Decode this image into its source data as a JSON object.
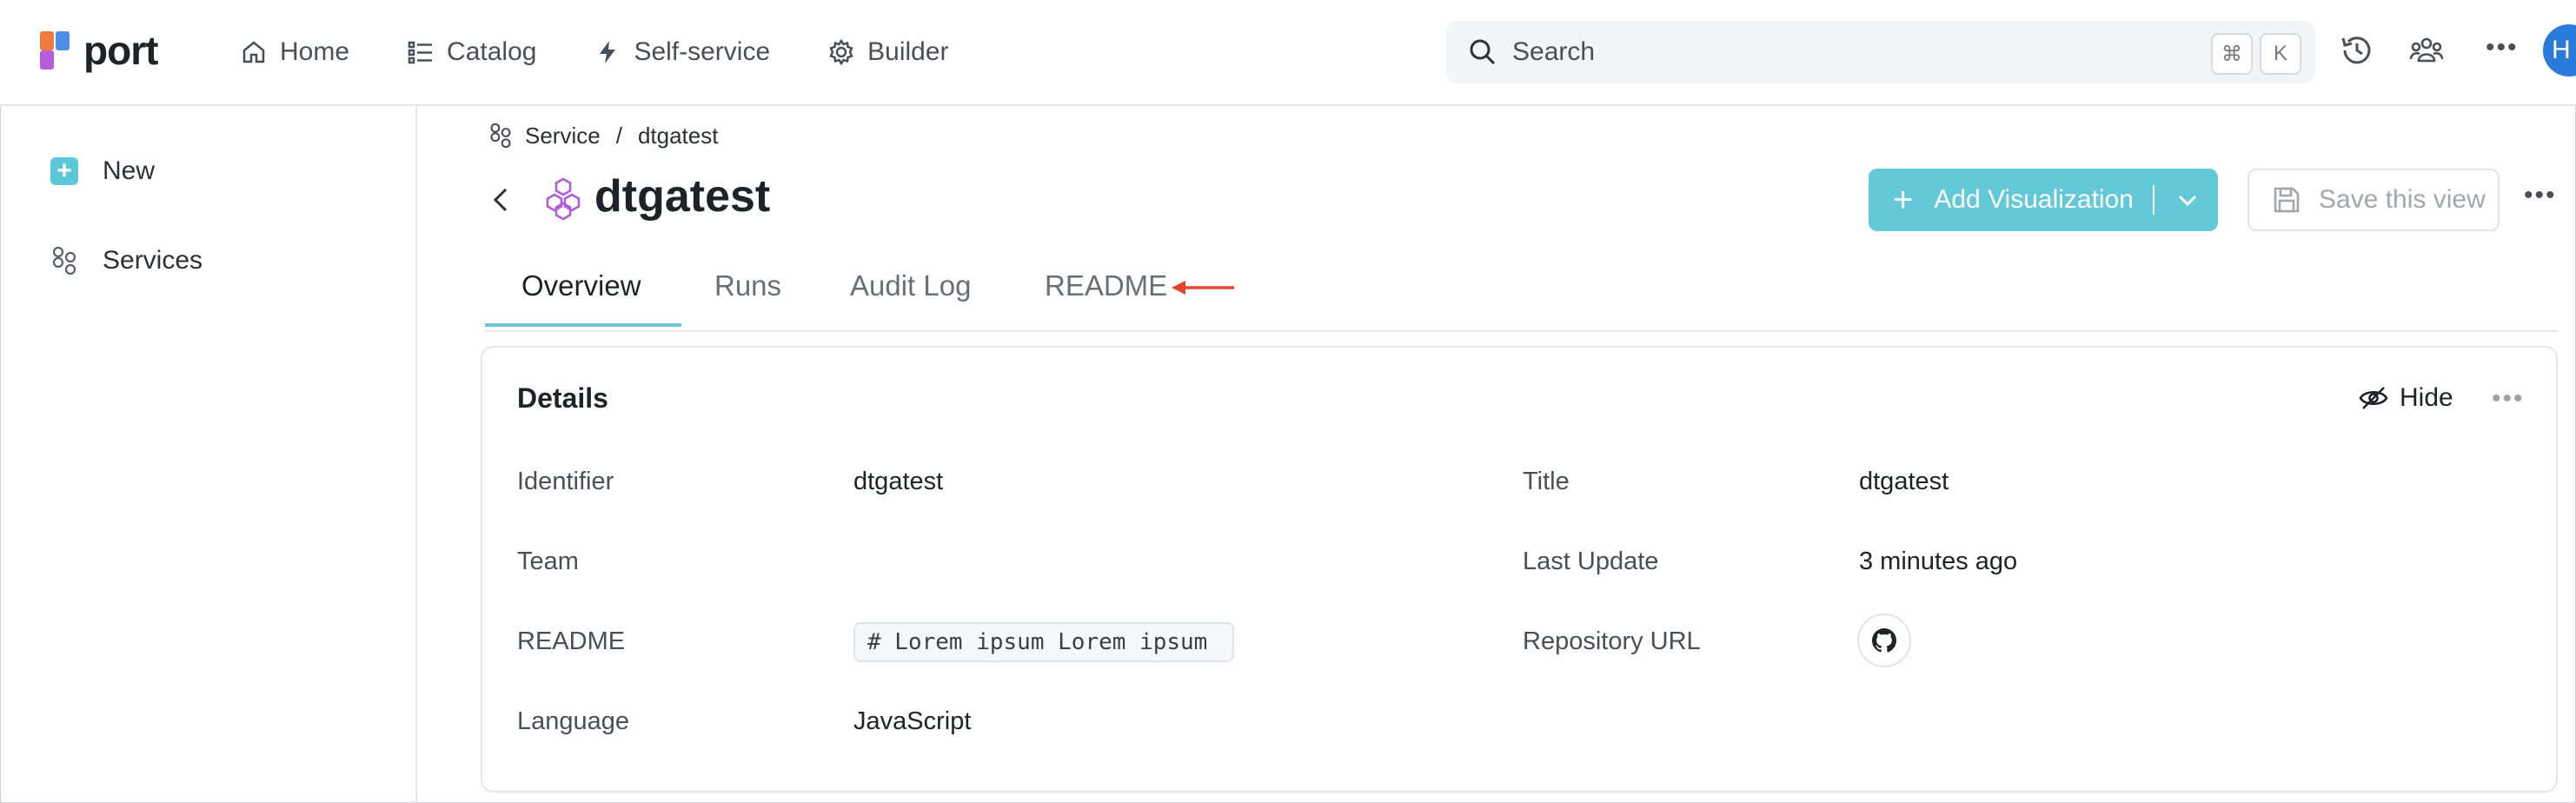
{
  "app": {
    "logo_text": "port"
  },
  "nav": {
    "home": "Home",
    "catalog": "Catalog",
    "self_service": "Self-service",
    "builder": "Builder"
  },
  "search": {
    "placeholder": "Search",
    "kbd_cmd": "⌘",
    "kbd_k": "K"
  },
  "user": {
    "avatar_initial": "H"
  },
  "sidebar": {
    "items": [
      {
        "label": "New",
        "icon": "plus-box-icon"
      },
      {
        "label": "Services",
        "icon": "blueprint-icon"
      }
    ]
  },
  "breadcrumb": {
    "parent": "Service",
    "separator": "/",
    "current": "dtgatest"
  },
  "page": {
    "title": "dtgatest"
  },
  "actions": {
    "add_visualization": "Add Visualization",
    "save_view": "Save this view"
  },
  "tabs": [
    {
      "label": "Overview",
      "active": true
    },
    {
      "label": "Runs",
      "active": false
    },
    {
      "label": "Audit Log",
      "active": false
    },
    {
      "label": "README",
      "active": false
    }
  ],
  "details": {
    "title": "Details",
    "hide_label": "Hide",
    "fields": {
      "identifier": {
        "label": "Identifier",
        "value": "dtgatest"
      },
      "team": {
        "label": "Team",
        "value": ""
      },
      "readme": {
        "label": "README",
        "value": "# Lorem ipsum Lorem ipsum"
      },
      "language": {
        "label": "Language",
        "value": "JavaScript"
      },
      "title": {
        "label": "Title",
        "value": "dtgatest"
      },
      "last_update": {
        "label": "Last Update",
        "value": "3 minutes ago"
      },
      "repository_url": {
        "label": "Repository URL",
        "icon": "github-icon"
      }
    }
  },
  "colors": {
    "accent": "#63c8d8",
    "annotation_arrow": "#e5432d",
    "entity_icon": "#b15be0"
  }
}
